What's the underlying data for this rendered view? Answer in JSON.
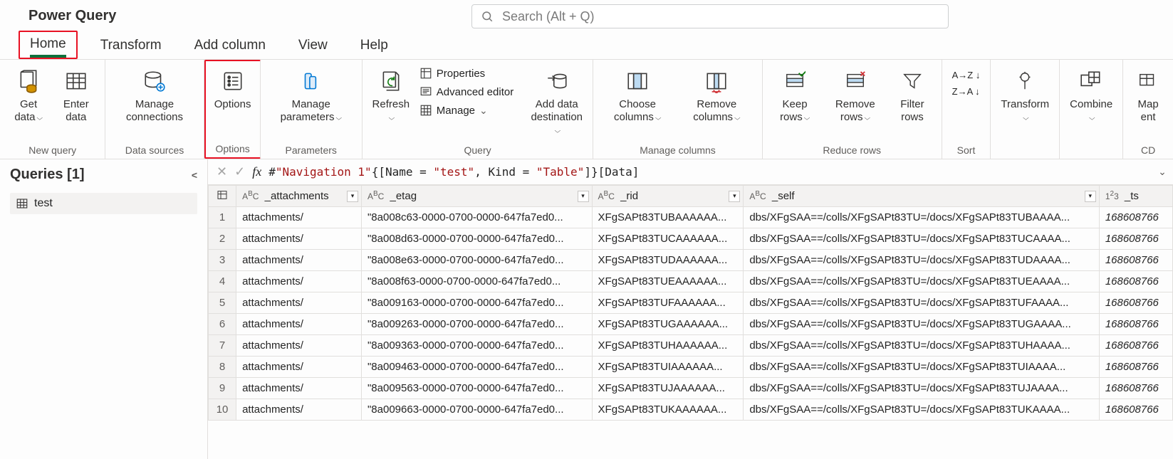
{
  "app": {
    "title": "Power Query"
  },
  "search": {
    "placeholder": "Search (Alt + Q)"
  },
  "tabs": {
    "home": "Home",
    "transform": "Transform",
    "add_column": "Add column",
    "view": "View",
    "help": "Help"
  },
  "ribbon": {
    "groups": {
      "new_query": "New query",
      "data_sources": "Data sources",
      "options": "Options",
      "parameters": "Parameters",
      "query": "Query",
      "manage_columns": "Manage columns",
      "reduce_rows": "Reduce rows",
      "sort": "Sort",
      "cdm": "CD"
    },
    "buttons": {
      "get_data": "Get data",
      "enter_data": "Enter data",
      "manage_connections": "Manage connections",
      "options": "Options",
      "manage_parameters": "Manage parameters",
      "refresh": "Refresh",
      "properties": "Properties",
      "advanced_editor": "Advanced editor",
      "manage": "Manage",
      "add_data_destination": "Add data destination",
      "choose_columns": "Choose columns",
      "remove_columns": "Remove columns",
      "keep_rows": "Keep rows",
      "remove_rows": "Remove rows",
      "filter_rows": "Filter rows",
      "transform": "Transform",
      "combine": "Combine",
      "map_entity": "Map ent"
    }
  },
  "queries": {
    "title": "Queries [1]",
    "items": [
      {
        "name": "test"
      }
    ]
  },
  "formula": {
    "prefix": "#",
    "nav": "\"Navigation 1\"",
    "mid1": "{[Name = ",
    "val1": "\"test\"",
    "mid2": ", Kind = ",
    "val2": "\"Table\"",
    "suffix": "]}[Data]"
  },
  "columns": [
    {
      "key": "_attachments",
      "type": "ABC"
    },
    {
      "key": "_etag",
      "type": "ABC"
    },
    {
      "key": "_rid",
      "type": "ABC"
    },
    {
      "key": "_self",
      "type": "ABC"
    },
    {
      "key": "_ts",
      "type": "123"
    }
  ],
  "rows": [
    {
      "n": 1,
      "_attachments": "attachments/",
      "_etag": "\"8a008c63-0000-0700-0000-647fa7ed0...",
      "_rid": "XFgSAPt83TUBAAAAAA...",
      "_self": "dbs/XFgSAA==/colls/XFgSAPt83TU=/docs/XFgSAPt83TUBAAAA...",
      "_ts": "168608766"
    },
    {
      "n": 2,
      "_attachments": "attachments/",
      "_etag": "\"8a008d63-0000-0700-0000-647fa7ed0...",
      "_rid": "XFgSAPt83TUCAAAAAA...",
      "_self": "dbs/XFgSAA==/colls/XFgSAPt83TU=/docs/XFgSAPt83TUCAAAA...",
      "_ts": "168608766"
    },
    {
      "n": 3,
      "_attachments": "attachments/",
      "_etag": "\"8a008e63-0000-0700-0000-647fa7ed0...",
      "_rid": "XFgSAPt83TUDAAAAAA...",
      "_self": "dbs/XFgSAA==/colls/XFgSAPt83TU=/docs/XFgSAPt83TUDAAAA...",
      "_ts": "168608766"
    },
    {
      "n": 4,
      "_attachments": "attachments/",
      "_etag": "\"8a008f63-0000-0700-0000-647fa7ed0...",
      "_rid": "XFgSAPt83TUEAAAAAA...",
      "_self": "dbs/XFgSAA==/colls/XFgSAPt83TU=/docs/XFgSAPt83TUEAAAA...",
      "_ts": "168608766"
    },
    {
      "n": 5,
      "_attachments": "attachments/",
      "_etag": "\"8a009163-0000-0700-0000-647fa7ed0...",
      "_rid": "XFgSAPt83TUFAAAAAA...",
      "_self": "dbs/XFgSAA==/colls/XFgSAPt83TU=/docs/XFgSAPt83TUFAAAA...",
      "_ts": "168608766"
    },
    {
      "n": 6,
      "_attachments": "attachments/",
      "_etag": "\"8a009263-0000-0700-0000-647fa7ed0...",
      "_rid": "XFgSAPt83TUGAAAAAA...",
      "_self": "dbs/XFgSAA==/colls/XFgSAPt83TU=/docs/XFgSAPt83TUGAAAA...",
      "_ts": "168608766"
    },
    {
      "n": 7,
      "_attachments": "attachments/",
      "_etag": "\"8a009363-0000-0700-0000-647fa7ed0...",
      "_rid": "XFgSAPt83TUHAAAAAA...",
      "_self": "dbs/XFgSAA==/colls/XFgSAPt83TU=/docs/XFgSAPt83TUHAAAA...",
      "_ts": "168608766"
    },
    {
      "n": 8,
      "_attachments": "attachments/",
      "_etag": "\"8a009463-0000-0700-0000-647fa7ed0...",
      "_rid": "XFgSAPt83TUIAAAAAA...",
      "_self": "dbs/XFgSAA==/colls/XFgSAPt83TU=/docs/XFgSAPt83TUIAAAA...",
      "_ts": "168608766"
    },
    {
      "n": 9,
      "_attachments": "attachments/",
      "_etag": "\"8a009563-0000-0700-0000-647fa7ed0...",
      "_rid": "XFgSAPt83TUJAAAAAA...",
      "_self": "dbs/XFgSAA==/colls/XFgSAPt83TU=/docs/XFgSAPt83TUJAAAA...",
      "_ts": "168608766"
    },
    {
      "n": 10,
      "_attachments": "attachments/",
      "_etag": "\"8a009663-0000-0700-0000-647fa7ed0...",
      "_rid": "XFgSAPt83TUKAAAAAA...",
      "_self": "dbs/XFgSAA==/colls/XFgSAPt83TU=/docs/XFgSAPt83TUKAAAA...",
      "_ts": "168608766"
    }
  ]
}
